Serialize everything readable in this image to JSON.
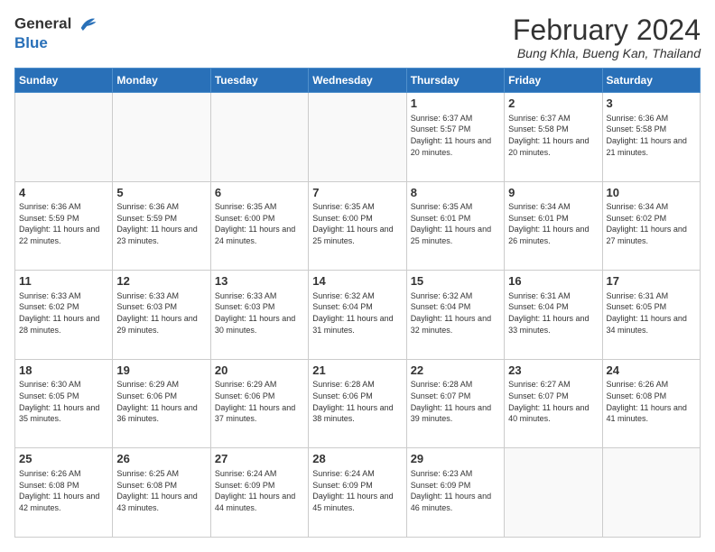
{
  "header": {
    "logo_line1": "General",
    "logo_line2": "Blue",
    "month_title": "February 2024",
    "location": "Bung Khla, Bueng Kan, Thailand"
  },
  "days_of_week": [
    "Sunday",
    "Monday",
    "Tuesday",
    "Wednesday",
    "Thursday",
    "Friday",
    "Saturday"
  ],
  "weeks": [
    [
      {
        "day": "",
        "info": ""
      },
      {
        "day": "",
        "info": ""
      },
      {
        "day": "",
        "info": ""
      },
      {
        "day": "",
        "info": ""
      },
      {
        "day": "1",
        "info": "Sunrise: 6:37 AM\nSunset: 5:57 PM\nDaylight: 11 hours and 20 minutes."
      },
      {
        "day": "2",
        "info": "Sunrise: 6:37 AM\nSunset: 5:58 PM\nDaylight: 11 hours and 20 minutes."
      },
      {
        "day": "3",
        "info": "Sunrise: 6:36 AM\nSunset: 5:58 PM\nDaylight: 11 hours and 21 minutes."
      }
    ],
    [
      {
        "day": "4",
        "info": "Sunrise: 6:36 AM\nSunset: 5:59 PM\nDaylight: 11 hours and 22 minutes."
      },
      {
        "day": "5",
        "info": "Sunrise: 6:36 AM\nSunset: 5:59 PM\nDaylight: 11 hours and 23 minutes."
      },
      {
        "day": "6",
        "info": "Sunrise: 6:35 AM\nSunset: 6:00 PM\nDaylight: 11 hours and 24 minutes."
      },
      {
        "day": "7",
        "info": "Sunrise: 6:35 AM\nSunset: 6:00 PM\nDaylight: 11 hours and 25 minutes."
      },
      {
        "day": "8",
        "info": "Sunrise: 6:35 AM\nSunset: 6:01 PM\nDaylight: 11 hours and 25 minutes."
      },
      {
        "day": "9",
        "info": "Sunrise: 6:34 AM\nSunset: 6:01 PM\nDaylight: 11 hours and 26 minutes."
      },
      {
        "day": "10",
        "info": "Sunrise: 6:34 AM\nSunset: 6:02 PM\nDaylight: 11 hours and 27 minutes."
      }
    ],
    [
      {
        "day": "11",
        "info": "Sunrise: 6:33 AM\nSunset: 6:02 PM\nDaylight: 11 hours and 28 minutes."
      },
      {
        "day": "12",
        "info": "Sunrise: 6:33 AM\nSunset: 6:03 PM\nDaylight: 11 hours and 29 minutes."
      },
      {
        "day": "13",
        "info": "Sunrise: 6:33 AM\nSunset: 6:03 PM\nDaylight: 11 hours and 30 minutes."
      },
      {
        "day": "14",
        "info": "Sunrise: 6:32 AM\nSunset: 6:04 PM\nDaylight: 11 hours and 31 minutes."
      },
      {
        "day": "15",
        "info": "Sunrise: 6:32 AM\nSunset: 6:04 PM\nDaylight: 11 hours and 32 minutes."
      },
      {
        "day": "16",
        "info": "Sunrise: 6:31 AM\nSunset: 6:04 PM\nDaylight: 11 hours and 33 minutes."
      },
      {
        "day": "17",
        "info": "Sunrise: 6:31 AM\nSunset: 6:05 PM\nDaylight: 11 hours and 34 minutes."
      }
    ],
    [
      {
        "day": "18",
        "info": "Sunrise: 6:30 AM\nSunset: 6:05 PM\nDaylight: 11 hours and 35 minutes."
      },
      {
        "day": "19",
        "info": "Sunrise: 6:29 AM\nSunset: 6:06 PM\nDaylight: 11 hours and 36 minutes."
      },
      {
        "day": "20",
        "info": "Sunrise: 6:29 AM\nSunset: 6:06 PM\nDaylight: 11 hours and 37 minutes."
      },
      {
        "day": "21",
        "info": "Sunrise: 6:28 AM\nSunset: 6:06 PM\nDaylight: 11 hours and 38 minutes."
      },
      {
        "day": "22",
        "info": "Sunrise: 6:28 AM\nSunset: 6:07 PM\nDaylight: 11 hours and 39 minutes."
      },
      {
        "day": "23",
        "info": "Sunrise: 6:27 AM\nSunset: 6:07 PM\nDaylight: 11 hours and 40 minutes."
      },
      {
        "day": "24",
        "info": "Sunrise: 6:26 AM\nSunset: 6:08 PM\nDaylight: 11 hours and 41 minutes."
      }
    ],
    [
      {
        "day": "25",
        "info": "Sunrise: 6:26 AM\nSunset: 6:08 PM\nDaylight: 11 hours and 42 minutes."
      },
      {
        "day": "26",
        "info": "Sunrise: 6:25 AM\nSunset: 6:08 PM\nDaylight: 11 hours and 43 minutes."
      },
      {
        "day": "27",
        "info": "Sunrise: 6:24 AM\nSunset: 6:09 PM\nDaylight: 11 hours and 44 minutes."
      },
      {
        "day": "28",
        "info": "Sunrise: 6:24 AM\nSunset: 6:09 PM\nDaylight: 11 hours and 45 minutes."
      },
      {
        "day": "29",
        "info": "Sunrise: 6:23 AM\nSunset: 6:09 PM\nDaylight: 11 hours and 46 minutes."
      },
      {
        "day": "",
        "info": ""
      },
      {
        "day": "",
        "info": ""
      }
    ]
  ]
}
